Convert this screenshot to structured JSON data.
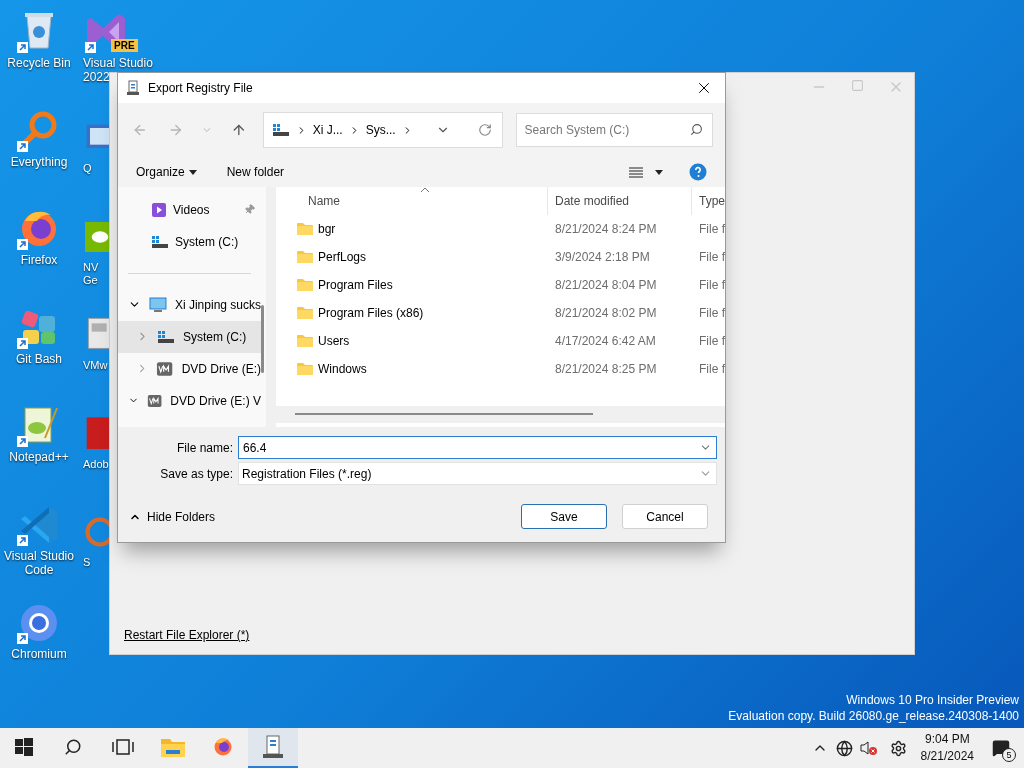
{
  "desktop": {
    "icons": [
      {
        "label": "Recycle Bin",
        "kind": "recycle"
      },
      {
        "label": "Everything",
        "kind": "everything"
      },
      {
        "label": "Firefox",
        "kind": "firefox"
      },
      {
        "label": "Git Bash",
        "kind": "git"
      },
      {
        "label": "Notepad++",
        "kind": "notepad"
      },
      {
        "label": "Visual Studio Code",
        "kind": "vscode"
      },
      {
        "label": "Chromium",
        "kind": "chromium"
      }
    ],
    "top_icon": {
      "label": "Visual Studio 2022",
      "kind": "vs",
      "badge": "PRE"
    },
    "partial_icons": [
      {
        "label": "Q",
        "kind": "qt"
      },
      {
        "label": "NV Ge",
        "kind": "nvidia"
      },
      {
        "label": "VMw",
        "kind": "vmware"
      },
      {
        "label": "Adob",
        "kind": "adobe"
      },
      {
        "label": "S",
        "kind": "s"
      }
    ]
  },
  "background_window": {
    "link": "Restart File Explorer (*)"
  },
  "dialog": {
    "title": "Export Registry File",
    "breadcrumb": [
      "Xi J...",
      "Sys..."
    ],
    "search_placeholder": "Search System (C:)",
    "organize": "Organize",
    "new_folder": "New folder",
    "quick_access": [
      {
        "label": "Videos",
        "kind": "videos",
        "pinned": true
      },
      {
        "label": "System (C:)",
        "kind": "drive",
        "pinned": false
      }
    ],
    "tree": [
      {
        "label": "Xi Jinping sucks",
        "kind": "pc",
        "expanded": true,
        "selected": false,
        "children": [
          {
            "label": "System (C:)",
            "kind": "drive",
            "expanded": false,
            "selected": true
          },
          {
            "label": "DVD Drive (E:)",
            "kind": "vm",
            "expanded": false,
            "selected": false
          }
        ]
      },
      {
        "label": "DVD Drive (E:) V",
        "kind": "vm",
        "expanded": true,
        "selected": false
      }
    ],
    "columns": [
      "Name",
      "Date modified",
      "Type"
    ],
    "rows": [
      {
        "name": "bgr",
        "date": "8/21/2024 8:24 PM",
        "type": "File f"
      },
      {
        "name": "PerfLogs",
        "date": "3/9/2024 2:18 PM",
        "type": "File f"
      },
      {
        "name": "Program Files",
        "date": "8/21/2024 8:04 PM",
        "type": "File f"
      },
      {
        "name": "Program Files (x86)",
        "date": "8/21/2024 8:02 PM",
        "type": "File f"
      },
      {
        "name": "Users",
        "date": "4/17/2024 6:42 AM",
        "type": "File f"
      },
      {
        "name": "Windows",
        "date": "8/21/2024 8:25 PM",
        "type": "File f"
      }
    ],
    "file_name_label": "File name:",
    "file_name": "66.4",
    "save_type_label": "Save as type:",
    "save_type": "Registration Files (*.reg)",
    "hide_folders": "Hide Folders",
    "buttons": [
      {
        "label": "Save",
        "default": true
      },
      {
        "label": "Cancel",
        "default": false
      }
    ]
  },
  "watermark": [
    "Windows 10 Pro Insider Preview",
    "Evaluation copy. Build 26080.ge_release.240308-1400"
  ],
  "taskbar": {
    "apps": [
      {
        "kind": "start",
        "selected": false
      },
      {
        "kind": "search",
        "selected": false
      },
      {
        "kind": "taskview",
        "selected": false
      },
      {
        "kind": "explorer",
        "selected": false
      },
      {
        "kind": "firefox",
        "selected": false
      },
      {
        "kind": "regedit",
        "selected": true
      }
    ],
    "time": "9:04 PM",
    "date": "8/21/2024",
    "notification_count": "5"
  }
}
